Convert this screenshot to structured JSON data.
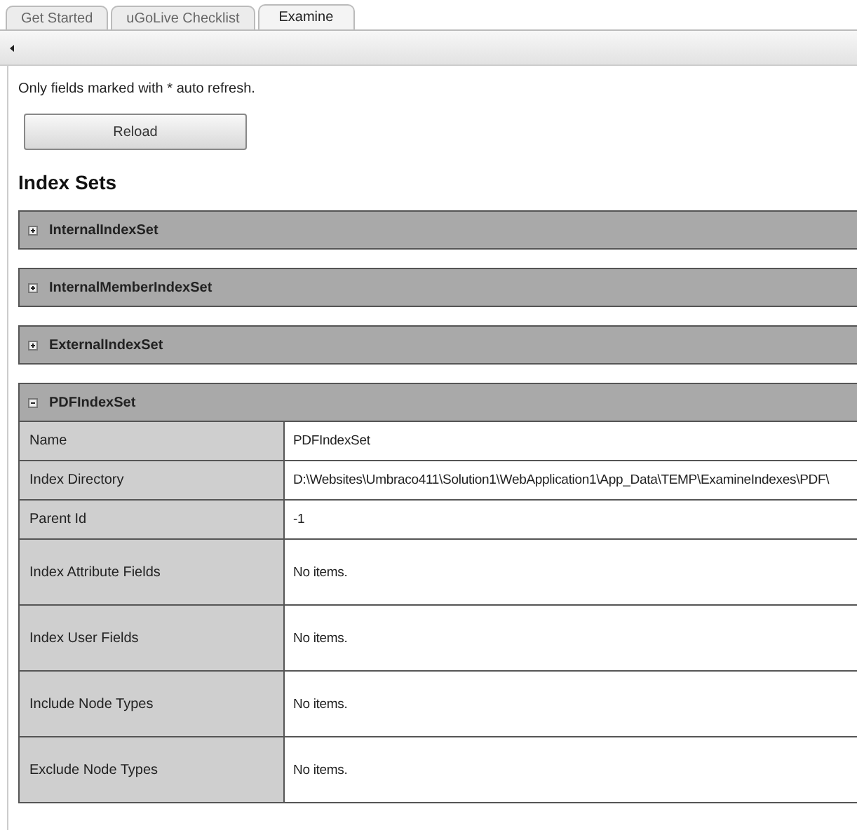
{
  "tabs": [
    {
      "label": "Get Started",
      "selected": false
    },
    {
      "label": "uGoLive Checklist",
      "selected": false
    },
    {
      "label": "Examine",
      "selected": true
    }
  ],
  "note": "Only fields marked with * auto refresh.",
  "reload_button": "Reload",
  "heading": "Index Sets",
  "index_sets": [
    {
      "name": "InternalIndexSet",
      "expanded": false
    },
    {
      "name": "InternalMemberIndexSet",
      "expanded": false
    },
    {
      "name": "ExternalIndexSet",
      "expanded": false
    },
    {
      "name": "PDFIndexSet",
      "expanded": true,
      "rows": [
        {
          "label": "Name",
          "value": "PDFIndexSet",
          "kind": "short"
        },
        {
          "label": "Index Directory",
          "value": "D:\\Websites\\Umbraco411\\Solution1\\WebApplication1\\App_Data\\TEMP\\ExamineIndexes\\PDF\\",
          "kind": "short"
        },
        {
          "label": "Parent Id",
          "value": "-1",
          "kind": "short"
        },
        {
          "label": "Index Attribute Fields",
          "value": "No items.",
          "kind": "tall"
        },
        {
          "label": "Index User Fields",
          "value": "No items.",
          "kind": "tall"
        },
        {
          "label": "Include Node Types",
          "value": "No items.",
          "kind": "tall"
        },
        {
          "label": "Exclude Node Types",
          "value": "No items.",
          "kind": "tall"
        }
      ]
    }
  ]
}
